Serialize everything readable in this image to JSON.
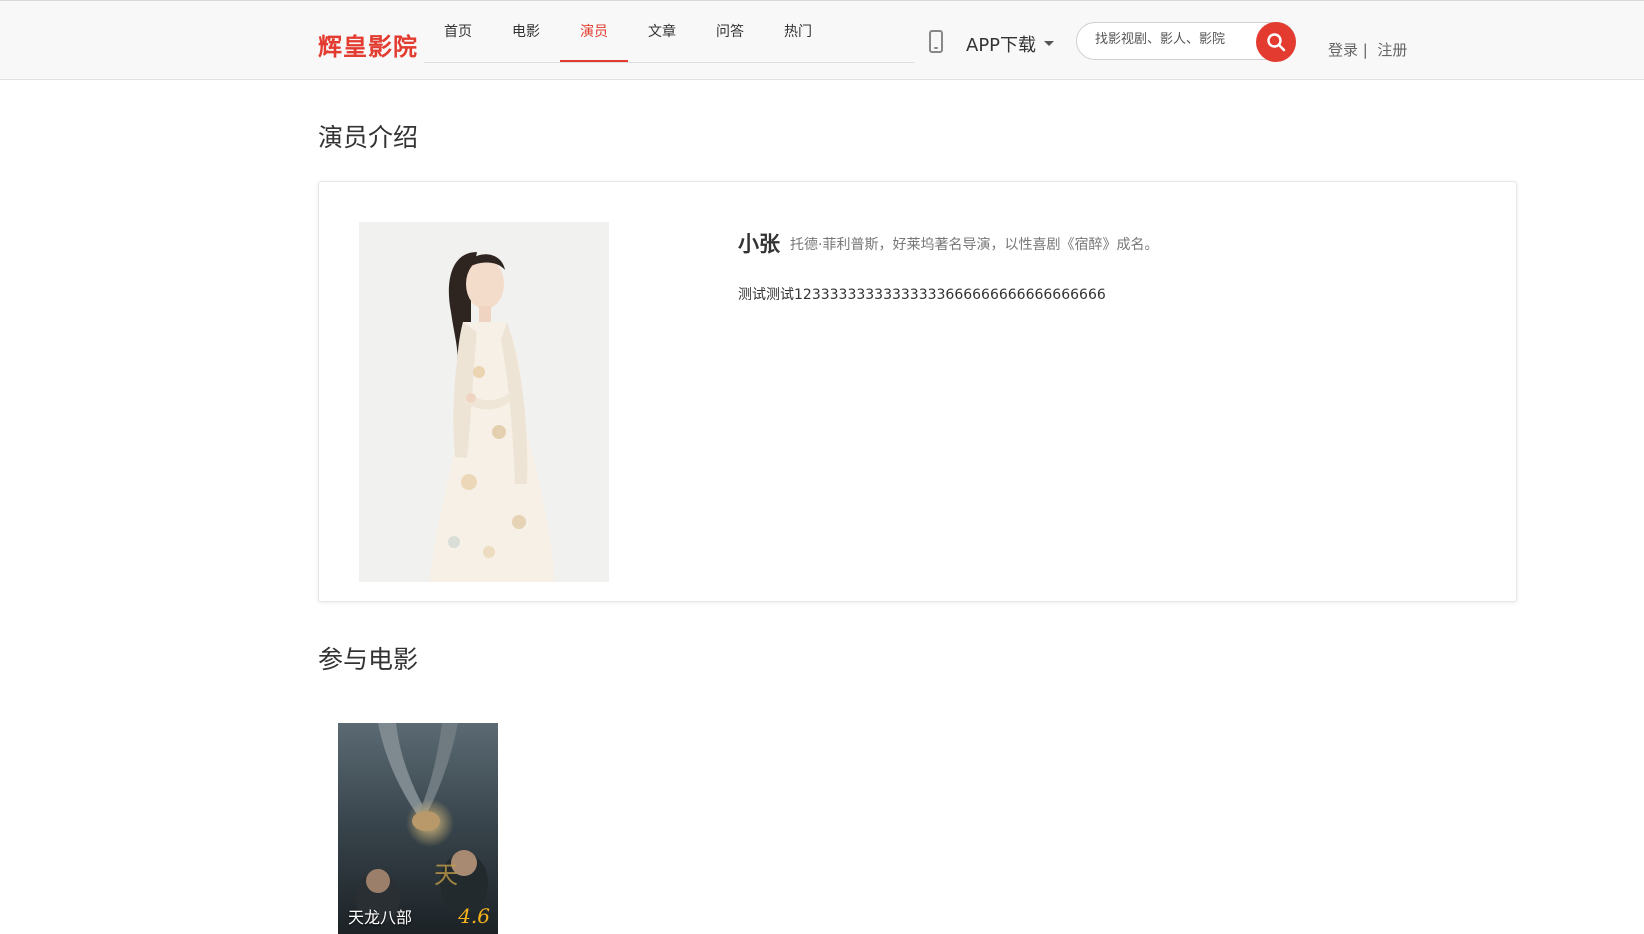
{
  "header": {
    "logo": "辉皇影院",
    "nav": [
      {
        "label": "首页",
        "active": false
      },
      {
        "label": "电影",
        "active": false
      },
      {
        "label": "演员",
        "active": true
      },
      {
        "label": "文章",
        "active": false
      },
      {
        "label": "问答",
        "active": false
      },
      {
        "label": "热门",
        "active": false
      }
    ],
    "app_download": "APP下载",
    "search_placeholder": "找影视剧、影人、影院",
    "login": "登录",
    "auth_separator": "|",
    "register": "注册"
  },
  "actor_section": {
    "title": "演员介绍",
    "name": "小张",
    "description": "托德·菲利普斯，好莱坞著名导演，以性喜剧《宿醉》成名。",
    "bio": "测试测试12333333333333333666666666666666666"
  },
  "movies_section": {
    "title": "参与电影",
    "movies": [
      {
        "title": "天龙八部",
        "score": "4.6"
      }
    ]
  },
  "colors": {
    "accent": "#e33b30",
    "score": "#f5b31b"
  }
}
